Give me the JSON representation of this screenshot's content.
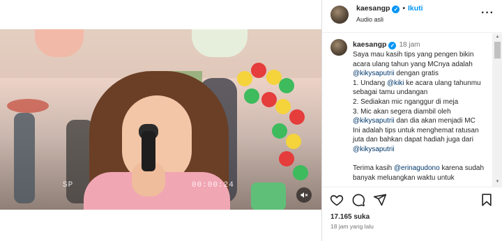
{
  "post": {
    "username": "kaesangp",
    "follow_label": "Ikuti",
    "audio_label": "Audio asli",
    "caption_time": "18 jam",
    "caption_lines": [
      {
        "parts": [
          {
            "t": "Saya mau kasih tips yang pengen bikin acara ulang tahun yang MCnya adalah ",
            "m": false
          }
        ]
      },
      {
        "parts": [
          {
            "t": "@kikysaputrii",
            "m": true
          },
          {
            "t": " dengan gratis",
            "m": false
          }
        ]
      },
      {
        "parts": [
          {
            "t": "1. Undang ",
            "m": false
          },
          {
            "t": "@kiki",
            "m": true
          },
          {
            "t": " ke acara ulang tahunmu sebagai tamu undangan",
            "m": false
          }
        ]
      },
      {
        "parts": [
          {
            "t": "2. Sediakan mic nganggur di meja",
            "m": false
          }
        ]
      },
      {
        "parts": [
          {
            "t": "3. Mic akan segera diambil oleh ",
            "m": false
          },
          {
            "t": "@kikysaputrii",
            "m": true
          },
          {
            "t": " dan dia akan menjadi MC",
            "m": false
          }
        ]
      },
      {
        "parts": [
          {
            "t": "Ini adalah tips untuk menghemat ratusan juta dan bahkan dapat hadiah juga dari ",
            "m": false
          },
          {
            "t": "@kikysaputrii",
            "m": true
          }
        ]
      },
      {
        "parts": [
          {
            "t": " ",
            "m": false
          }
        ]
      },
      {
        "parts": [
          {
            "t": "Terima kasih ",
            "m": false
          },
          {
            "t": "@erinagudono",
            "m": true
          },
          {
            "t": " karena sudah banyak meluangkan waktu untuk",
            "m": false
          }
        ]
      }
    ],
    "likes": "17.165 suka",
    "posted_ago": "18 jam yang lalu"
  },
  "video": {
    "osd_left": "SP",
    "osd_timecode": "00:00:24"
  },
  "icons": {
    "like": "heart-icon",
    "comment": "comment-icon",
    "share": "share-icon",
    "save": "bookmark-icon",
    "more": "more-icon",
    "mute": "mute-icon",
    "verified": "verified-badge-icon"
  },
  "colors": {
    "accent": "#0095f6",
    "mention": "#00376b",
    "muted_text": "#737373"
  }
}
